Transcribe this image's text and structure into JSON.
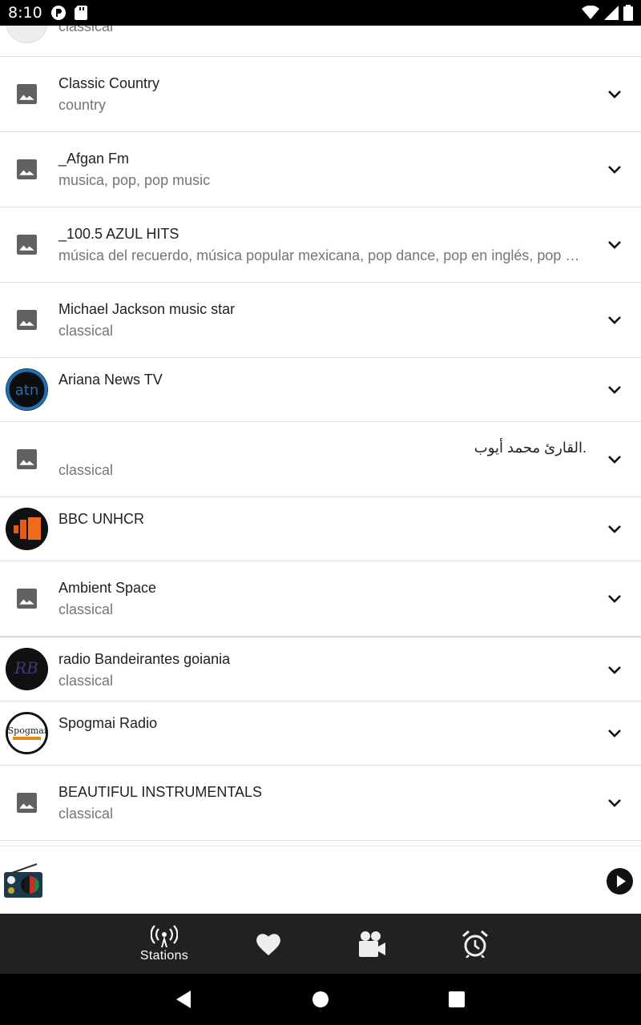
{
  "status_bar": {
    "time": "8:10"
  },
  "stations": [
    {
      "title": "",
      "subtitle": "classical",
      "thumb": "logo-gray"
    },
    {
      "title": "Classic Country",
      "subtitle": "country",
      "thumb": "placeholder"
    },
    {
      "title": "_Afgan Fm",
      "subtitle": "musica, pop, pop music",
      "thumb": "placeholder"
    },
    {
      "title": "_100.5 AZUL HITS",
      "subtitle": "música del recuerdo, música popular mexicana, pop dance, pop en inglés, pop en español",
      "thumb": "placeholder"
    },
    {
      "title": "Michael Jackson music star",
      "subtitle": "classical",
      "thumb": "placeholder"
    },
    {
      "title": "Ariana News TV",
      "subtitle": "",
      "thumb": "atn-logo"
    },
    {
      "title": ".القارئ محمد أيوب",
      "subtitle": "classical",
      "thumb": "placeholder"
    },
    {
      "title": "BBC UNHCR",
      "subtitle": "",
      "thumb": "bbc-logo"
    },
    {
      "title": "Ambient Space",
      "subtitle": "classical",
      "thumb": "placeholder"
    },
    {
      "title": "radio Bandeirantes goiania",
      "subtitle": "classical",
      "thumb": "rb-logo"
    },
    {
      "title": "Spogmai Radio",
      "subtitle": "",
      "thumb": "spogmai-logo"
    },
    {
      "title": "BEAUTIFUL INSTRUMENTALS",
      "subtitle": "classical",
      "thumb": "placeholder"
    }
  ],
  "bottom_nav": {
    "stations_label": "Stations",
    "items": [
      "radio-tower-icon",
      "heart-icon",
      "video-camera-icon",
      "alarm-clock-icon"
    ]
  },
  "colors": {
    "nav_bg": "#212121",
    "status_bg": "#000000",
    "title": "#212121",
    "subtitle": "#757575"
  }
}
